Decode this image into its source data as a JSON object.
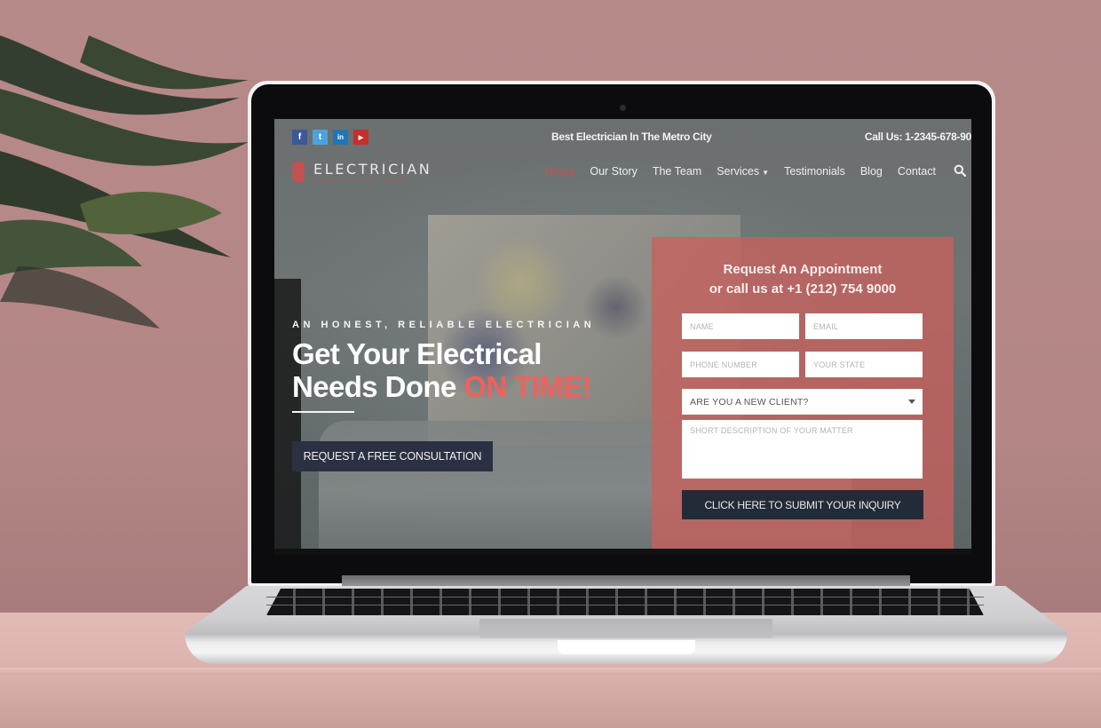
{
  "site": {
    "topbar": {
      "social": [
        {
          "name": "facebook",
          "glyph": "f",
          "color": "#3b5998"
        },
        {
          "name": "twitter",
          "glyph": "t",
          "color": "#4aa3df"
        },
        {
          "name": "linkedin",
          "glyph": "in",
          "color": "#1f78b4"
        },
        {
          "name": "youtube",
          "glyph": "▶",
          "color": "#c4302b"
        }
      ],
      "tagline": "Best Electrician In The Metro City",
      "call": "Call Us: 1-2345-678-90"
    },
    "logo": {
      "name": "ELECTRICIAN",
      "tagline": "POWERING MY HOME"
    },
    "nav": {
      "items": [
        {
          "label": "Home",
          "active": true
        },
        {
          "label": "Our Story"
        },
        {
          "label": "The Team"
        },
        {
          "label": "Services",
          "dropdown": true
        },
        {
          "label": "Testimonials"
        },
        {
          "label": "Blog"
        },
        {
          "label": "Contact"
        }
      ],
      "search_icon": "search-icon"
    },
    "hero": {
      "kicker": "AN HONEST, RELIABLE ELECTRICIAN",
      "headline_line1": "Get Your Electrical",
      "headline_line2": "Needs Done ",
      "headline_accent": "ON TIME!",
      "cta": "REQUEST A FREE CONSULTATION"
    },
    "form": {
      "title_line1": "Request An Appointment",
      "title_line2": "or call us at +1 (212) 754 9000",
      "name_placeholder": "NAME",
      "email_placeholder": "EMAIL",
      "phone_placeholder": "PHONE NUMBER",
      "state_placeholder": "YOUR STATE",
      "client_select": "ARE YOU A NEW CLIENT?",
      "description_placeholder": "SHORT DESCRIPTION OF YOUR MATTER",
      "submit": "CLICK HERE TO SUBMIT YOUR INQUIRY"
    },
    "colors": {
      "accent": "#f0615d",
      "nav_active": "#c75350",
      "form_panel": "#c8605c",
      "dark_button": "#2b3142"
    }
  }
}
